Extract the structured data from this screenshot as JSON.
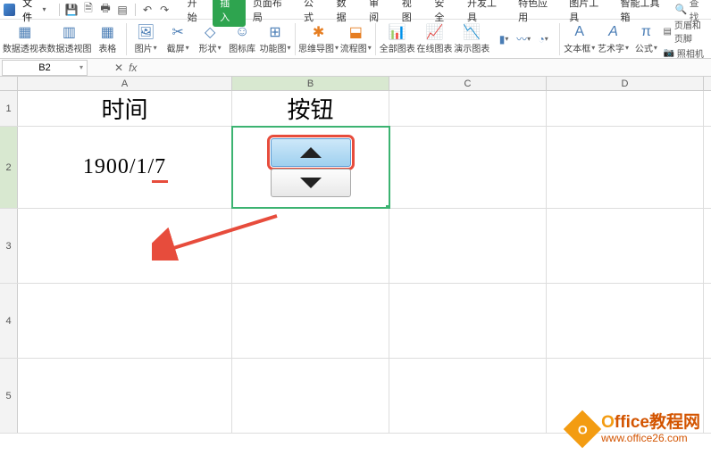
{
  "menubar": {
    "file_label": "文件",
    "tabs": [
      "开始",
      "插入",
      "页面布局",
      "公式",
      "数据",
      "审阅",
      "视图",
      "安全",
      "开发工具",
      "特色应用",
      "图片工具",
      "智能工具箱"
    ],
    "active_tab_index": 1,
    "search_label": "查找"
  },
  "ribbon": {
    "groups": [
      {
        "label": "数据透视表"
      },
      {
        "label": "数据透视图"
      },
      {
        "label": "表格"
      },
      {
        "label": "图片",
        "dd": true
      },
      {
        "label": "截屏",
        "dd": true
      },
      {
        "label": "形状",
        "dd": true
      },
      {
        "label": "图标库"
      },
      {
        "label": "功能图",
        "dd": true
      },
      {
        "label": "思维导图",
        "dd": true
      },
      {
        "label": "流程图",
        "dd": true
      },
      {
        "label": "全部图表"
      },
      {
        "label": "在线图表"
      },
      {
        "label": "演示图表"
      },
      {
        "label": "文本框",
        "dd": true
      },
      {
        "label": "艺术字",
        "dd": true
      },
      {
        "label": "公式",
        "dd": true
      }
    ],
    "right_items": [
      "页眉和页脚",
      "照相机"
    ]
  },
  "namebox": "B2",
  "grid": {
    "cols": [
      "A",
      "B",
      "C",
      "D"
    ],
    "rows": [
      "1",
      "2",
      "3",
      "4",
      "5"
    ],
    "header_row": {
      "A": "时间",
      "B": "按钮"
    },
    "date_value": "1900/1/7"
  },
  "watermark": {
    "line1_o": "O",
    "line1_rest": "ffice教程网",
    "line2": "www.office26.com"
  }
}
